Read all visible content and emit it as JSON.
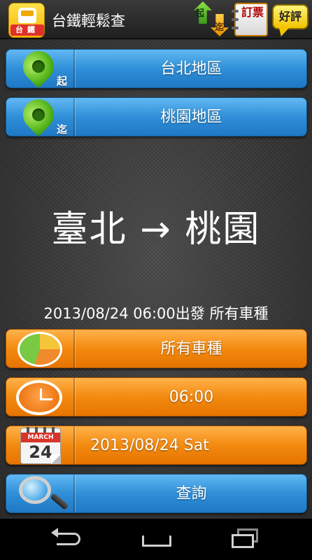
{
  "app": {
    "title": "台鐵輕鬆查",
    "logo_text": "台鐵"
  },
  "toolbar": {
    "swap": {
      "top_label": "起",
      "bottom_label": "迄"
    },
    "ticket_label": "訂票",
    "review_label": "好評"
  },
  "origin": {
    "tag": "起",
    "label": "台北地區"
  },
  "destination": {
    "tag": "迄",
    "label": "桃園地區"
  },
  "route": {
    "from": "臺北",
    "arrow": "→",
    "to": "桃園"
  },
  "summary": "2013/08/24 06:00出發 所有車種",
  "options": {
    "train_type": {
      "label": "所有車種"
    },
    "time": {
      "label": "06:00"
    },
    "date": {
      "label": "2013/08/24 Sat",
      "calendar_month": "MARCH",
      "calendar_day": "24"
    },
    "search": {
      "label": "查詢"
    }
  },
  "colors": {
    "blue_row": "#2f8fd8",
    "orange_row": "#f38a10",
    "pin_green": "#58b81e"
  },
  "icons": [
    "train-logo-icon",
    "swap-icon",
    "ticket-icon",
    "review-icon",
    "location-pin-icon",
    "pie-chart-icon",
    "clock-icon",
    "calendar-icon",
    "magnifier-icon",
    "back-icon",
    "home-icon",
    "recent-apps-icon"
  ]
}
